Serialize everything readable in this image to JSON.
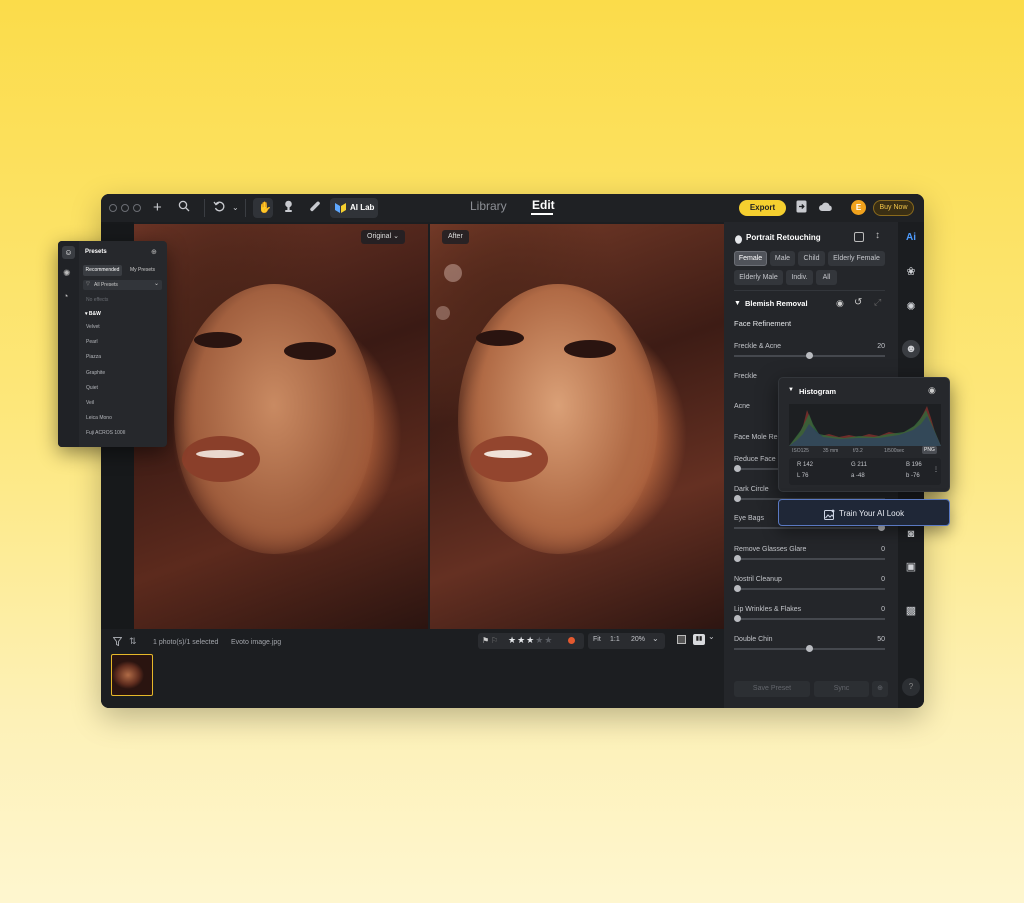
{
  "titlebar": {
    "ai_lab_label": "AI Lab",
    "tabs": [
      {
        "label": "Library"
      },
      {
        "label": "Edit"
      }
    ],
    "export_label": "Export",
    "avatar_initial": "E",
    "buy_now_label": "Buy Now"
  },
  "viewer": {
    "left_tag": "Original",
    "right_tag": "After"
  },
  "bottombar": {
    "selection_text": "1 photo(s)/1 selected",
    "filename": "Evoto image.jpg",
    "rating": 3,
    "fit_label": "Fit",
    "one_to_one_label": "1:1",
    "zoom_label": "20%"
  },
  "right_panel": {
    "title": "Portrait Retouching",
    "chips": [
      "Female",
      "Male",
      "Child",
      "Elderly Female",
      "Elderly Male",
      "Indiv.",
      "All"
    ],
    "blemish_title": "Blemish Removal",
    "face_refinement_label": "Face Refinement",
    "params": [
      {
        "label": "Freckle & Acne",
        "value": "20"
      },
      {
        "label": "Freckle",
        "value": ""
      },
      {
        "label": "Acne",
        "value": ""
      },
      {
        "label": "Face Mole Re",
        "value": ""
      },
      {
        "label": "Reduce Face",
        "value": ""
      },
      {
        "label": "Dark Circle",
        "value": "0"
      },
      {
        "label": "Eye Bags",
        "value": "100"
      },
      {
        "label": "Remove Glasses Glare",
        "value": "0"
      },
      {
        "label": "Nostril Cleanup",
        "value": "0"
      },
      {
        "label": "Lip Wrinkles & Flakes",
        "value": "0"
      },
      {
        "label": "Double Chin",
        "value": "50"
      }
    ],
    "save_preset_label": "Save Preset",
    "sync_label": "Sync"
  },
  "presets_popup": {
    "title": "Presets",
    "tabs": [
      "Recommended",
      "My Presets"
    ],
    "filter_label": "All Presets",
    "no_effects": "No effects",
    "group_label": "B&W",
    "items": [
      "Velvet",
      "Pearl",
      "Piazza",
      "Graphite",
      "Quiet",
      "Veil",
      "Leica Mono",
      "Fuji ACROS 100II"
    ]
  },
  "histogram": {
    "title": "Histogram",
    "iso": "ISO125",
    "focal": "35 mm",
    "aperture": "f/3.2",
    "shutter": "1/500sec",
    "format": "PNG",
    "r": "R 142",
    "g": "G 211",
    "b": "B 196",
    "l": "L 76",
    "a": "a -48",
    "bb": "b -76"
  },
  "train_label": "Train Your AI Look",
  "colors": {
    "accent_yellow": "#f5cf2f",
    "app_bg": "#1c1e21",
    "panel_bg": "#24262a",
    "train_border": "#5a79c2"
  }
}
